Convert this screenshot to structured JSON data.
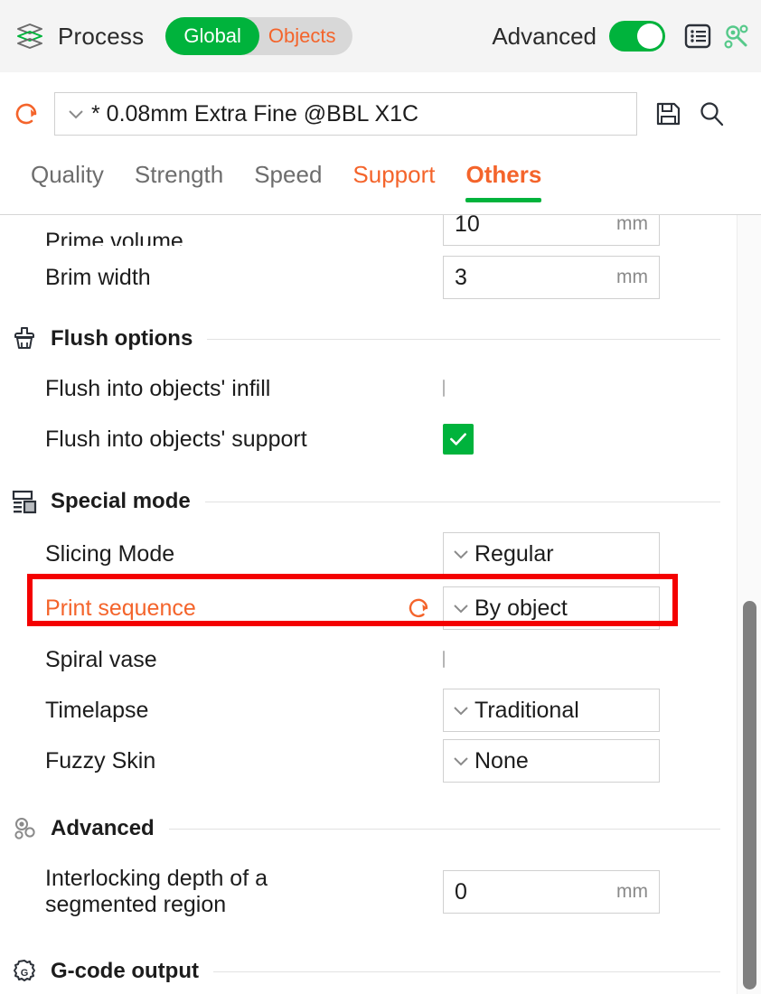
{
  "topbar": {
    "process_icon": "layers-stack-icon",
    "process_label": "Process",
    "segmented": {
      "global_label": "Global",
      "objects_label": "Objects",
      "selected": "Global"
    },
    "advanced_label": "Advanced",
    "advanced_toggle_state": "on",
    "list_icon": "list-view-icon",
    "search_settings_icon": "gear-search-icon"
  },
  "preset": {
    "reset_icon": "reset-arrow-icon",
    "caret_icon": "chevron-down-icon",
    "value": "* 0.08mm Extra Fine @BBL X1C",
    "save_icon": "save-floppy-icon",
    "search_icon": "search-magnifier-icon"
  },
  "tabs": [
    {
      "label": "Quality",
      "state": "normal"
    },
    {
      "label": "Strength",
      "state": "normal"
    },
    {
      "label": "Speed",
      "state": "normal"
    },
    {
      "label": "Support",
      "state": "modified"
    },
    {
      "label": "Others",
      "state": "active"
    }
  ],
  "settings": {
    "prime_volume": {
      "label": "Prime volume",
      "value": "10",
      "unit": "mm"
    },
    "brim_width": {
      "label": "Brim width",
      "value": "3",
      "unit": "mm"
    },
    "flush_group": {
      "title": "Flush options",
      "icon": "brush-icon"
    },
    "flush_infill": {
      "label": "Flush into objects' infill",
      "checked": "false"
    },
    "flush_support": {
      "label": "Flush into objects' support",
      "checked": "true",
      "check_glyph": "✓"
    },
    "special_group": {
      "title": "Special mode",
      "icon": "panel-layout-icon"
    },
    "slicing_mode": {
      "label": "Slicing Mode",
      "value": "Regular"
    },
    "print_sequence": {
      "label": "Print sequence",
      "value": "By object",
      "modified": "true",
      "reset_icon": "reset-arrow-icon",
      "highlighted": "true"
    },
    "spiral_vase": {
      "label": "Spiral vase",
      "checked": "false"
    },
    "timelapse": {
      "label": "Timelapse",
      "value": "Traditional"
    },
    "fuzzy_skin": {
      "label": "Fuzzy Skin",
      "value": "None"
    },
    "advanced_group": {
      "title": "Advanced",
      "icon": "gears-icon"
    },
    "interlocking_depth": {
      "label_line1": "Interlocking depth of a",
      "label_line2": "segmented region",
      "value": "0",
      "unit": "mm"
    },
    "gcode_group": {
      "title": "G-code output",
      "icon": "gear-g-icon"
    }
  },
  "colors": {
    "accent_green": "#00b33c",
    "accent_orange": "#f4642b",
    "highlight_red": "#f40000",
    "text": "#1c1c1c",
    "muted": "#8a8a8a"
  },
  "scrollbar": {
    "orientation": "vertical",
    "thumb_position": "bottom"
  }
}
